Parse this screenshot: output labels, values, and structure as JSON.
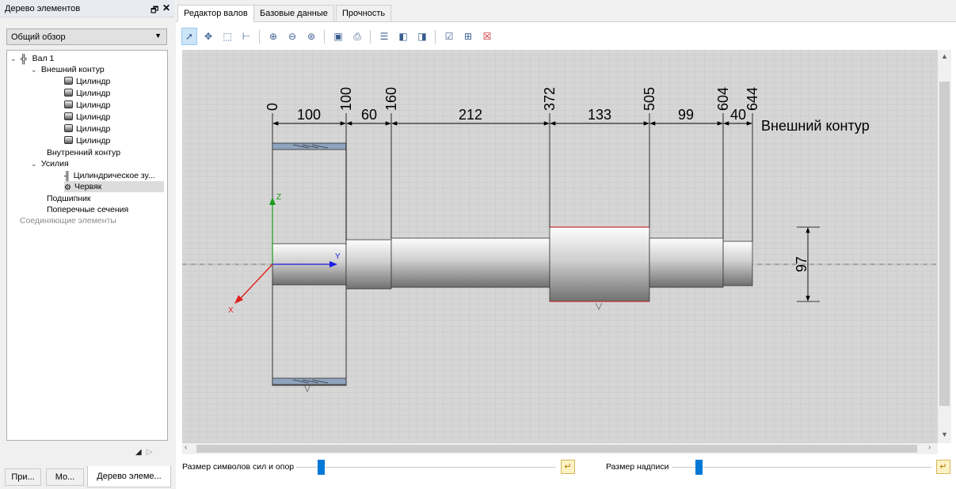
{
  "left_panel": {
    "title": "Дерево элементов",
    "pin_glyph": "🗗",
    "close_glyph": "✕",
    "view_combo": {
      "value": "Общий обзор"
    },
    "tree": {
      "root": "Вал 1",
      "outer_contour": "Внешний контур",
      "cylinders": [
        "Цилиндр",
        "Цилиндр",
        "Цилиндр",
        "Цилиндр",
        "Цилиндр",
        "Цилиндр"
      ],
      "inner_contour": "Внутренний контур",
      "forces": "Усилия",
      "cylindrical_gear": "Цилиндрическое зу...",
      "worm": "Червяк",
      "bearing": "Подшипник",
      "cross_sections": "Поперечные сечения",
      "connecting_elements": "Соединяющие элементы"
    },
    "bottom_tabs": [
      "При...",
      "Мо...",
      "Дерево элеме..."
    ]
  },
  "tabs": [
    "Редактор валов",
    "Базовые данные",
    "Прочность"
  ],
  "toolbar": {
    "icons": [
      "cursor-icon",
      "pan-icon",
      "zoom-window-icon",
      "measure-icon",
      "zoom-in-icon",
      "zoom-out-icon",
      "zoom-fit-icon",
      "save-icon",
      "print-icon",
      "list-icon",
      "mirror-icon",
      "mirror-copy-icon",
      "checkbox-icon",
      "add-icon",
      "delete-icon"
    ]
  },
  "drawing": {
    "positions": [
      "0",
      "100",
      "160",
      "372",
      "505",
      "604",
      "644"
    ],
    "segment_lengths": [
      "100",
      "60",
      "212",
      "133",
      "99",
      "40"
    ],
    "contour_label": "Внешний контур",
    "diameter_label": "97",
    "axis_x": "X",
    "axis_y": "Y",
    "axis_z": "Z"
  },
  "bottom": {
    "slider1_label": "Размер символов сил и опор",
    "slider2_label": "Размер надписи"
  },
  "colors": {
    "grid_bg": "#d6d6d6",
    "axis_x": "#e0201b",
    "axis_y": "#1a1ae6",
    "axis_z": "#1a9a1a",
    "gear_fill": "#8ea3bd",
    "accent": "#0078d7"
  }
}
